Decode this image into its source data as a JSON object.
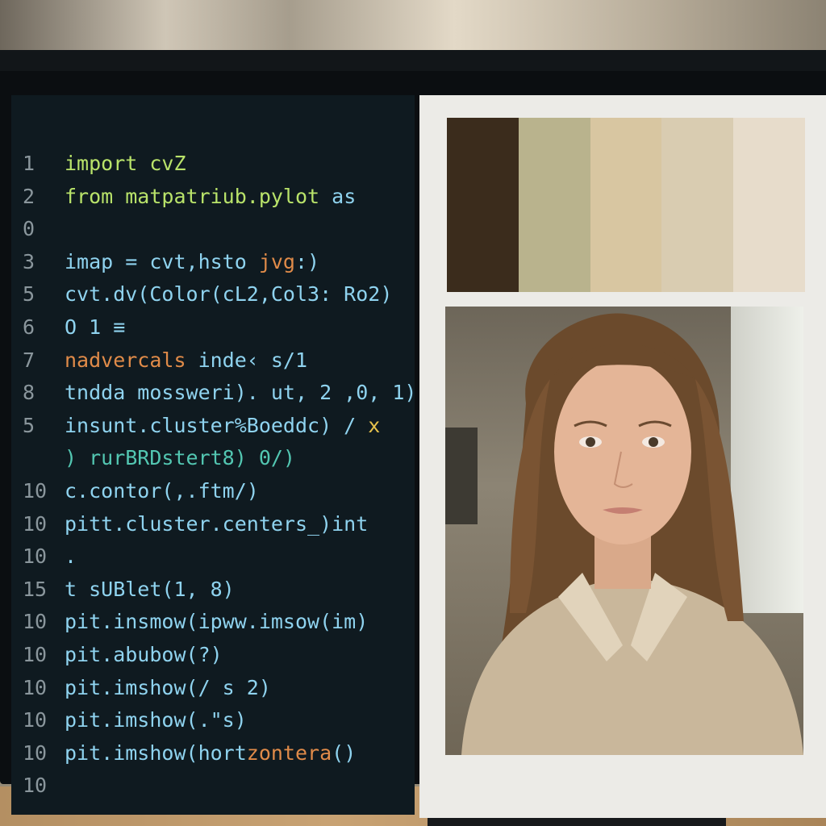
{
  "editor": {
    "lines": [
      {
        "num": "1",
        "parts": [
          {
            "t": "import cvZ",
            "c": "kw"
          }
        ]
      },
      {
        "num": "2",
        "parts": [
          {
            "t": "from matpatriub.pylot ",
            "c": "kw"
          },
          {
            "t": "as",
            "c": ""
          }
        ]
      },
      {
        "num": "0",
        "parts": []
      },
      {
        "num": "3",
        "parts": [
          {
            "t": "imap = cvt,hsto ",
            "c": ""
          },
          {
            "t": "jvg",
            "c": "org"
          },
          {
            "t": ":)",
            "c": ""
          }
        ]
      },
      {
        "num": "5",
        "parts": [
          {
            "t": "cvt.dv(Color(cL2,Col3: Ro2)",
            "c": ""
          }
        ]
      },
      {
        "num": "6",
        "parts": [
          {
            "t": "O 1 ≡",
            "c": ""
          }
        ]
      },
      {
        "num": "7",
        "parts": [
          {
            "t": "nadvercals ",
            "c": "org"
          },
          {
            "t": "inde‹ s/1",
            "c": ""
          }
        ]
      },
      {
        "num": "8",
        "parts": [
          {
            "t": "tndda mossweri). ut, 2 ,0, 1)",
            "c": ""
          }
        ]
      },
      {
        "num": "5",
        "parts": [
          {
            "t": "insunt.cluster%Boeddc) / ",
            "c": ""
          },
          {
            "t": "x",
            "c": "yel"
          }
        ]
      },
      {
        "num": "",
        "parts": [
          {
            "t": " ) rurBRDstert8) 0/)",
            "c": "teal"
          }
        ]
      },
      {
        "num": "10",
        "parts": [
          {
            "t": "c.contor(,.ftm/)",
            "c": ""
          }
        ]
      },
      {
        "num": "10",
        "parts": [
          {
            "t": "pitt.cluster.centers_)int",
            "c": ""
          }
        ]
      },
      {
        "num": "10",
        "parts": [
          {
            "t": ".",
            "c": ""
          }
        ]
      },
      {
        "num": "15",
        "parts": [
          {
            "t": "t sUBlet(1, 8)",
            "c": ""
          }
        ]
      },
      {
        "num": "10",
        "parts": [
          {
            "t": "pit.insmow(ipww.imsow(im)",
            "c": ""
          }
        ]
      },
      {
        "num": "10",
        "parts": [
          {
            "t": "pit.abubow(?)",
            "c": ""
          }
        ]
      },
      {
        "num": "10",
        "parts": [
          {
            "t": "pit.imshow(/ s 2)",
            "c": ""
          }
        ]
      },
      {
        "num": "10",
        "parts": [
          {
            "t": "pit.imshow(.\"s)",
            "c": ""
          }
        ]
      },
      {
        "num": "10",
        "parts": [
          {
            "t": "pit.imshow(hort",
            "c": ""
          },
          {
            "t": "zontera",
            "c": "org"
          },
          {
            "t": "()",
            "c": ""
          }
        ]
      },
      {
        "num": "10",
        "parts": []
      }
    ]
  },
  "palette": {
    "swatches": [
      "#3b2c1c",
      "#b9b38d",
      "#d8c6a1",
      "#d9ccb1",
      "#e7dccb"
    ]
  },
  "photo": {
    "subject": "portrait of woman with long brown hair in beige shirt"
  }
}
